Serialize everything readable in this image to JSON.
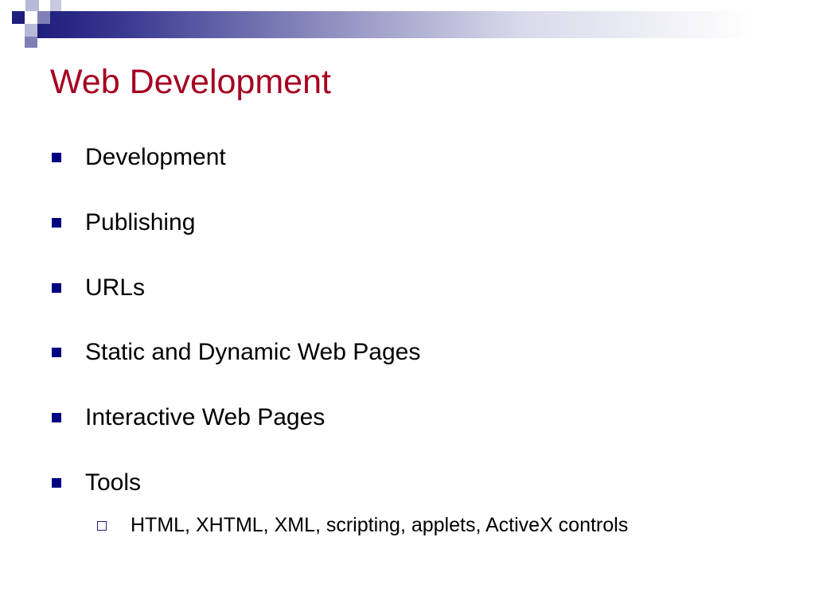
{
  "slide": {
    "title": "Web Development",
    "bullets": [
      {
        "text": "Development"
      },
      {
        "text": "Publishing"
      },
      {
        "text": "URLs"
      },
      {
        "text": "Static and Dynamic Web Pages"
      },
      {
        "text": "Interactive Web Pages"
      },
      {
        "text": "Tools"
      }
    ],
    "sub_bullets": [
      {
        "text": "HTML, XHTML, XML, scripting, applets, ActiveX controls"
      }
    ]
  },
  "colors": {
    "title": "#a50021",
    "bullet_marker": "#000080",
    "band_dark": "#1c1c7a",
    "band_light": "#ffffff"
  },
  "icons": {
    "bullet": "filled-square-bullet-icon",
    "sub_bullet": "hollow-square-bullet-icon",
    "decor": "checkered-squares-decoration"
  }
}
